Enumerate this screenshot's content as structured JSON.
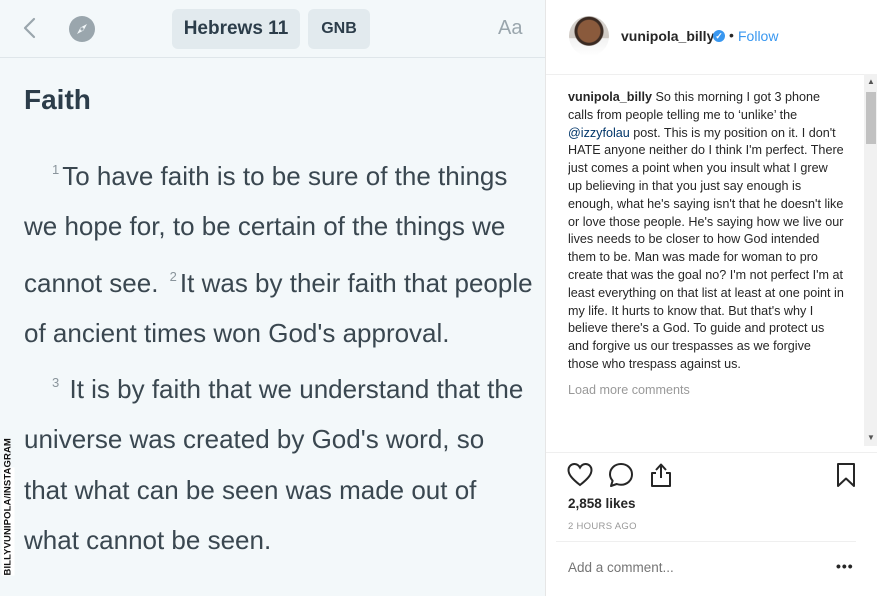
{
  "bible": {
    "book_chapter": "Hebrews 11",
    "version": "GNB",
    "font_button": "Aa",
    "heading": "Faith",
    "verses": [
      {
        "num": "1",
        "text": "To have faith is to be sure of the things we hope for, to be certain of the things we cannot see."
      },
      {
        "num": "2",
        "text": "It was by their faith that people of ancient times won God's approval."
      },
      {
        "num": "3",
        "text": "It is by faith that we understand that the universe was created by God's word, so that what can be seen was made out of what cannot be seen."
      }
    ],
    "icons": [
      "chevron-left-icon",
      "compass-icon"
    ],
    "colors": {
      "background": "#f3f8fa",
      "text": "#3a4750",
      "pill": "#e2eaee"
    }
  },
  "credit": "BILLYVUNIPOLA/INSTAGRAM",
  "instagram": {
    "username": "vunipola_billy",
    "follow_label": "Follow",
    "separator": "•",
    "caption_user": "vunipola_billy",
    "caption_part1": "So this morning I got 3 phone calls from people telling me to ‘unlike’ the",
    "caption_mention": "@izzyfolau",
    "caption_part2": "post. This is my position on it. I don't HATE anyone neither do I think I'm perfect. There just comes a point when you insult what I grew up believing in that you just say enough is enough, what he's saying isn't that he doesn't like or love those people. He's saying how we live our lives needs to be closer to how God intended them to be. Man was made for woman to pro create that was the goal no? I'm not perfect I'm at least everything on that list at least at one point in my life. It hurts to know that. But that's why I believe there's a God. To guide and protect us and forgive us our trespasses as we forgive those who trespass against us.",
    "load_more": "Load more comments",
    "likes": "2,858 likes",
    "time": "2 HOURS AGO",
    "comment_placeholder": "Add a comment...",
    "more_label": "•••",
    "icons": [
      "heart-icon",
      "comment-icon",
      "share-icon",
      "bookmark-icon",
      "verified-icon"
    ],
    "colors": {
      "link": "#3897f0",
      "text": "#262626",
      "muted": "#999999"
    }
  }
}
